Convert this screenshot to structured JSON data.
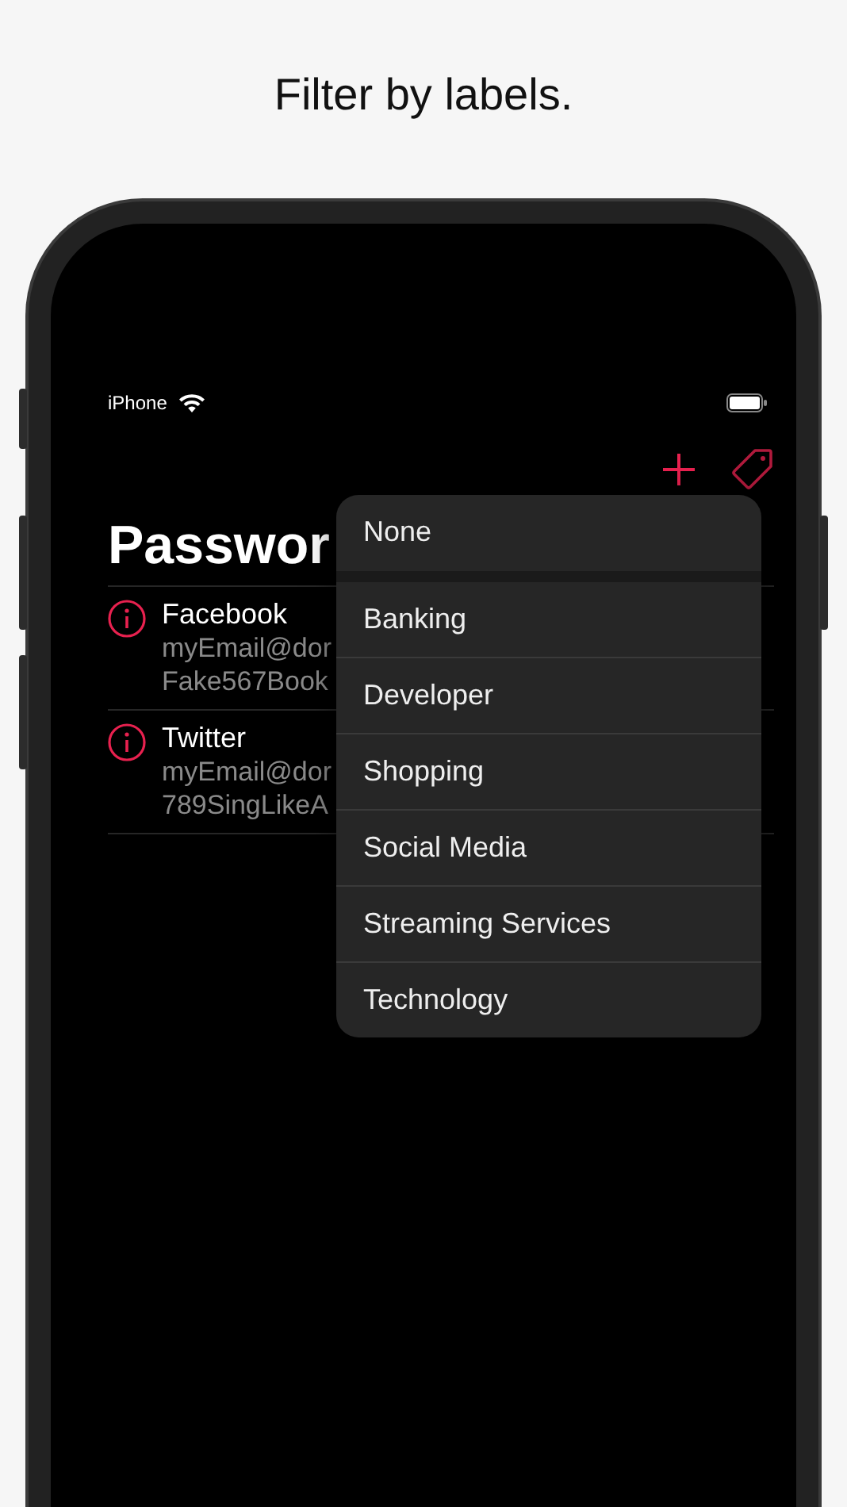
{
  "caption": "Filter by labels.",
  "status_bar": {
    "carrier": "iPhone"
  },
  "title": "Passwor",
  "entries": [
    {
      "name": "Facebook",
      "lines": [
        "myEmail@dor",
        "Fake567Book"
      ]
    },
    {
      "name": "Twitter",
      "lines": [
        "myEmail@dor",
        "789SingLikeA"
      ]
    }
  ],
  "label_menu": {
    "items": [
      {
        "label": "None",
        "kind": "clear"
      },
      {
        "label": "Banking",
        "kind": "label"
      },
      {
        "label": "Developer",
        "kind": "label"
      },
      {
        "label": "Shopping",
        "kind": "label"
      },
      {
        "label": "Social Media",
        "kind": "label"
      },
      {
        "label": "Streaming Services",
        "kind": "label"
      },
      {
        "label": "Technology",
        "kind": "label"
      }
    ]
  }
}
